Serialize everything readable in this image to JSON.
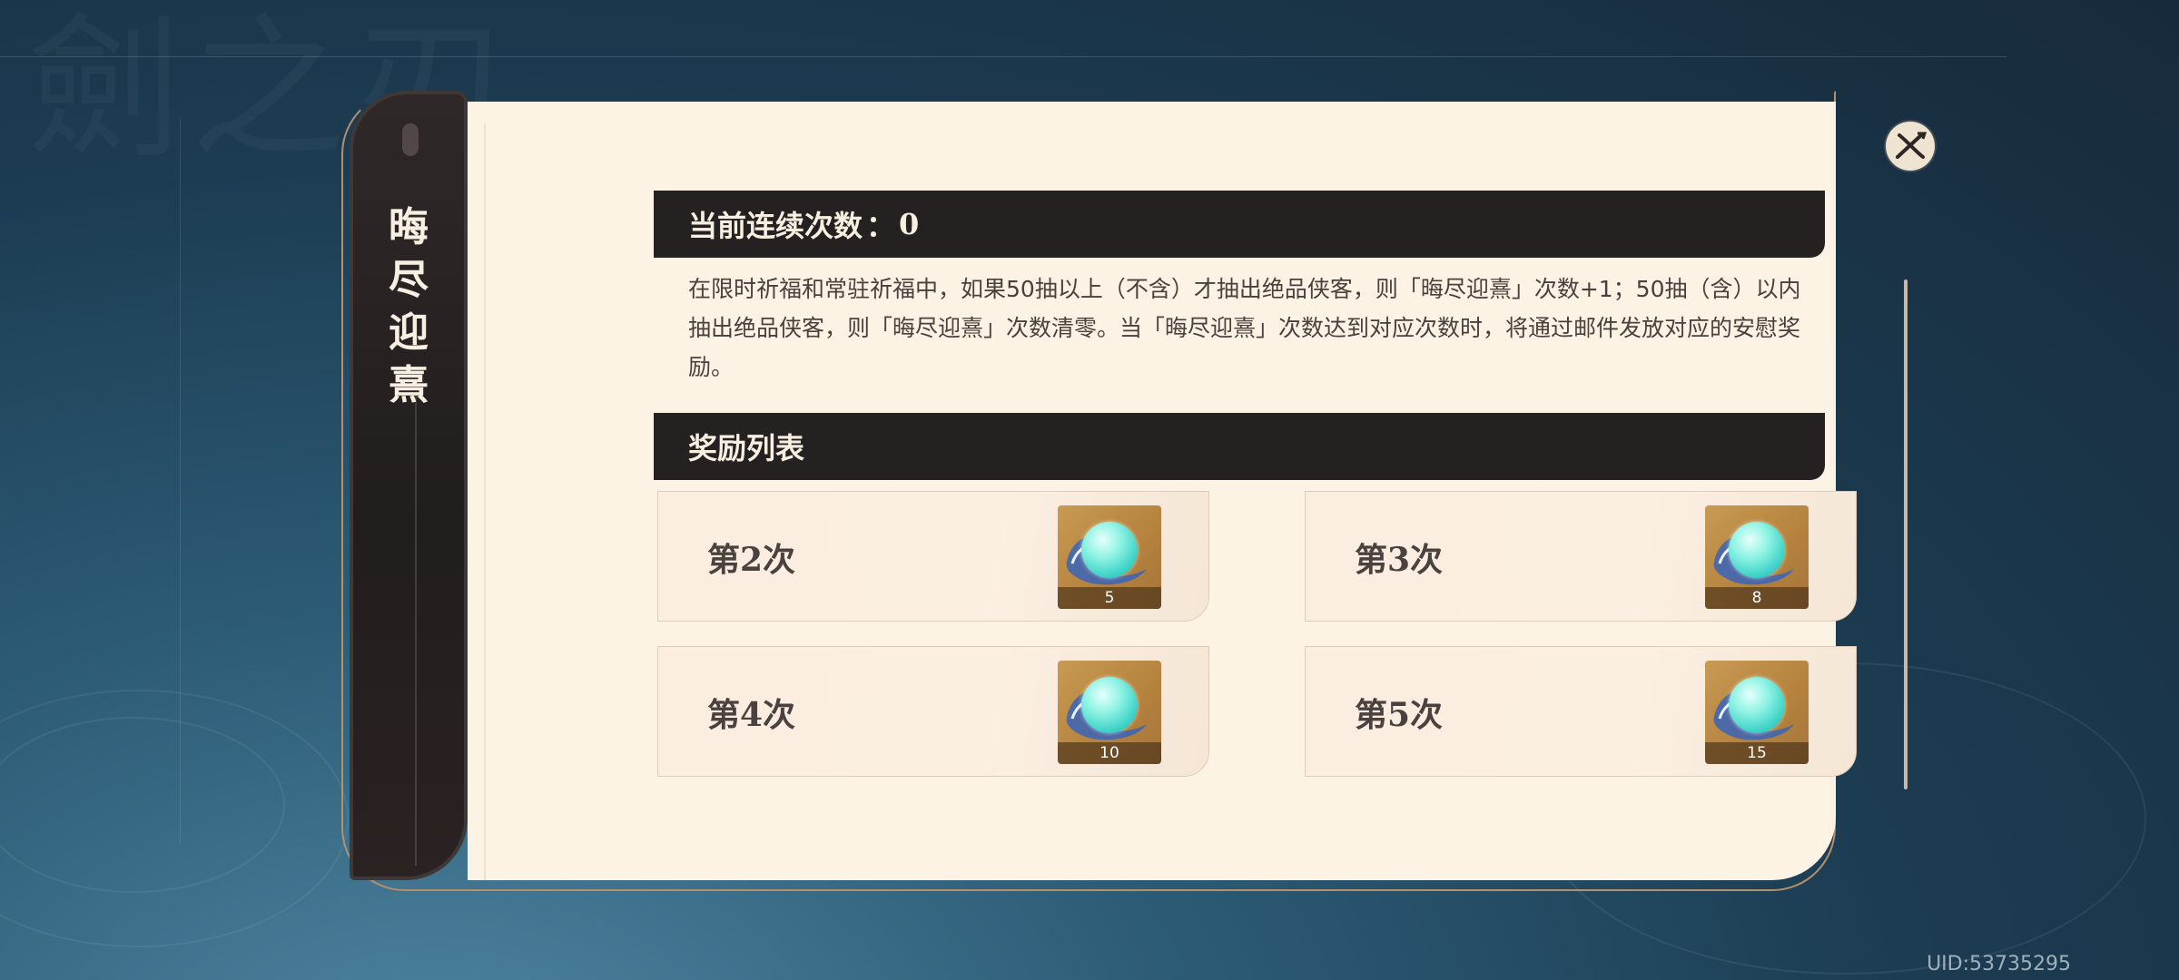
{
  "side_tab": {
    "title_chars": [
      "晦",
      "尽",
      "迎",
      "熹"
    ]
  },
  "current": {
    "label": "当前连续次数",
    "separator": "：",
    "value": "0"
  },
  "description": "在限时祈福和常驻祈福中，如果50抽以上（不含）才抽出绝品侠客，则「晦尽迎熹」次数+1；50抽（含）以内抽出绝品侠客，则「晦尽迎熹」次数清零。当「晦尽迎熹」次数达到对应次数时，将通过邮件发放对应的安慰奖励。",
  "rewards_header": "奖励列表",
  "rewards": [
    {
      "label": "第2次",
      "item_icon": "cyan-orb-icon",
      "count": "5"
    },
    {
      "label": "第3次",
      "item_icon": "cyan-orb-icon",
      "count": "8"
    },
    {
      "label": "第4次",
      "item_icon": "cyan-orb-icon",
      "count": "10"
    },
    {
      "label": "第5次",
      "item_icon": "cyan-orb-icon",
      "count": "15"
    }
  ],
  "close_icon": "close-icon",
  "uid": "UID:53735295",
  "colors": {
    "panel_bg": "#fdf3e4",
    "header_bg": "#262121",
    "frame_border": "#b6906b",
    "orb": "#3fd3c8"
  }
}
